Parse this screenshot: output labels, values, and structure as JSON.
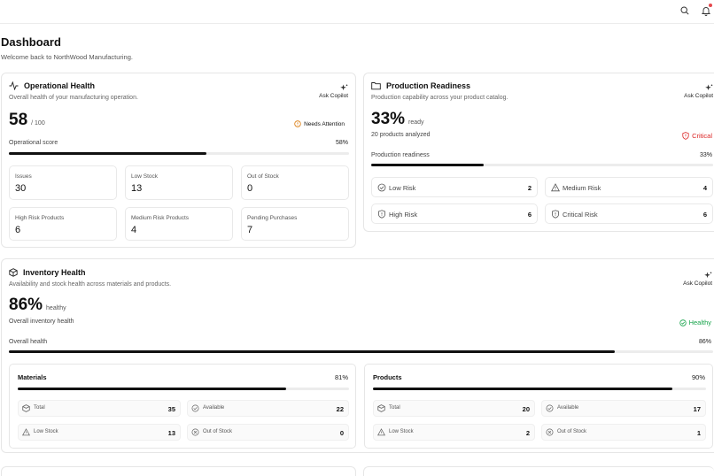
{
  "header": {
    "title": "Dashboard",
    "subtitle": "Welcome back to NorthWood Manufacturing."
  },
  "topbar": {
    "icons": [
      "search-icon",
      "bell-icon"
    ]
  },
  "operational": {
    "title": "Operational Health",
    "description": "Overall health of your manufacturing operation.",
    "copilot": "Ask Copilot",
    "score": "58",
    "score_max": "/ 100",
    "status": "Needs Attention",
    "status_color": "#d97706",
    "bar_label": "Operational score",
    "bar_pct_text": "58%",
    "bar_value": 0.58,
    "stats": [
      {
        "label": "Issues",
        "value": "30"
      },
      {
        "label": "Low Stock",
        "value": "13"
      },
      {
        "label": "Out of Stock",
        "value": "0"
      },
      {
        "label": "High Risk Products",
        "value": "6"
      },
      {
        "label": "Medium Risk Products",
        "value": "4"
      },
      {
        "label": "Pending Purchases",
        "value": "7"
      }
    ]
  },
  "production": {
    "title": "Production Readiness",
    "description": "Production capability across your product catalog.",
    "copilot": "Ask Copilot",
    "percent": "33%",
    "percent_suffix": "ready",
    "analyzed": "20 products analyzed",
    "status": "Critical",
    "status_color": "#dc2626",
    "bar_label": "Production readiness",
    "bar_pct_text": "33%",
    "bar_value": 0.33,
    "risks": [
      {
        "label": "Low Risk",
        "value": "2",
        "icon": "check-circle-icon"
      },
      {
        "label": "Medium Risk",
        "value": "4",
        "icon": "warning-triangle-icon"
      },
      {
        "label": "High Risk",
        "value": "6",
        "icon": "shield-alert-icon"
      },
      {
        "label": "Critical Risk",
        "value": "6",
        "icon": "shield-alert-icon"
      }
    ]
  },
  "inventory": {
    "title": "Inventory Health",
    "description": "Availability and stock health across materials and products.",
    "copilot": "Ask Copilot",
    "percent": "86%",
    "percent_suffix": "healthy",
    "subtext": "Overall inventory health",
    "status": "Healthy",
    "status_color": "#16a34a",
    "bar_label": "Overall health",
    "bar_pct_text": "86%",
    "bar_value": 0.86,
    "materials": {
      "title": "Materials",
      "pct_text": "81%",
      "bar_value": 0.81,
      "total_label": "Total",
      "total": "35",
      "available_label": "Available",
      "available": "22",
      "low_label": "Low Stock",
      "low": "13",
      "out_label": "Out of Stock",
      "out": "0"
    },
    "products": {
      "title": "Products",
      "pct_text": "90%",
      "bar_value": 0.9,
      "total_label": "Total",
      "total": "20",
      "available_label": "Available",
      "available": "17",
      "low_label": "Low Stock",
      "low": "2",
      "out_label": "Out of Stock",
      "out": "1"
    }
  }
}
